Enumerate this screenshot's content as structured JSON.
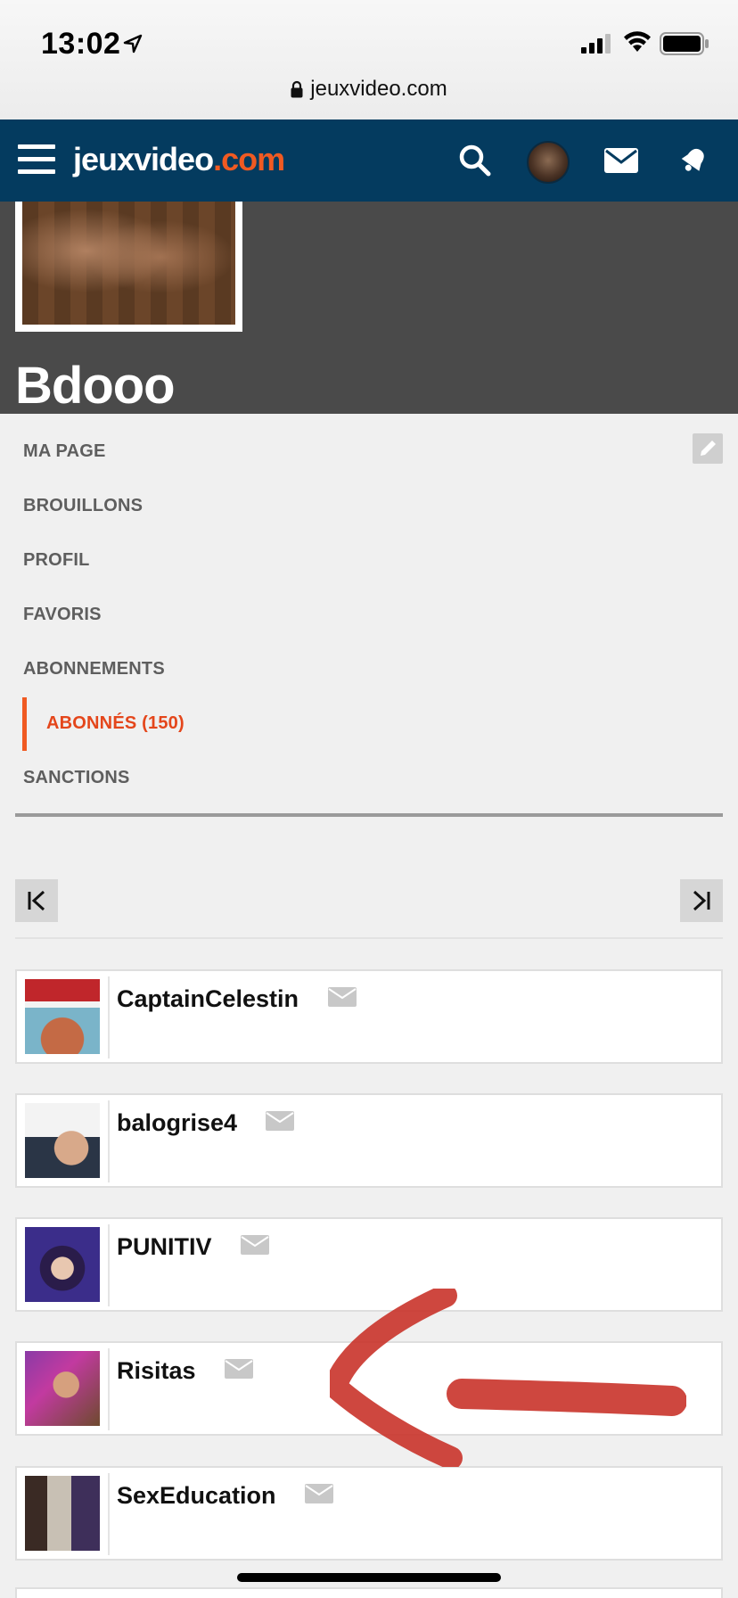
{
  "status_bar": {
    "time": "13:02",
    "url": "jeuxvideo.com"
  },
  "header": {
    "logo_main": "jeuxvideo",
    "logo_tld": ".com"
  },
  "profile": {
    "username": "Bdooo"
  },
  "menu": {
    "items": [
      {
        "label": "MA PAGE"
      },
      {
        "label": "BROUILLONS"
      },
      {
        "label": "PROFIL"
      },
      {
        "label": "FAVORIS"
      },
      {
        "label": "ABONNEMENTS"
      },
      {
        "label": "ABONNÉS (150)",
        "active": true
      },
      {
        "label": "SANCTIONS"
      }
    ]
  },
  "followers": [
    {
      "name": "CaptainCelestin"
    },
    {
      "name": "balogrise4"
    },
    {
      "name": "PUNITIV"
    },
    {
      "name": "Risitas"
    },
    {
      "name": "SexEducation"
    }
  ],
  "colors": {
    "header_bg": "#043b5f",
    "accent": "#f05a22",
    "banner_bg": "#4a4a4a",
    "annotation": "#c9332a"
  }
}
